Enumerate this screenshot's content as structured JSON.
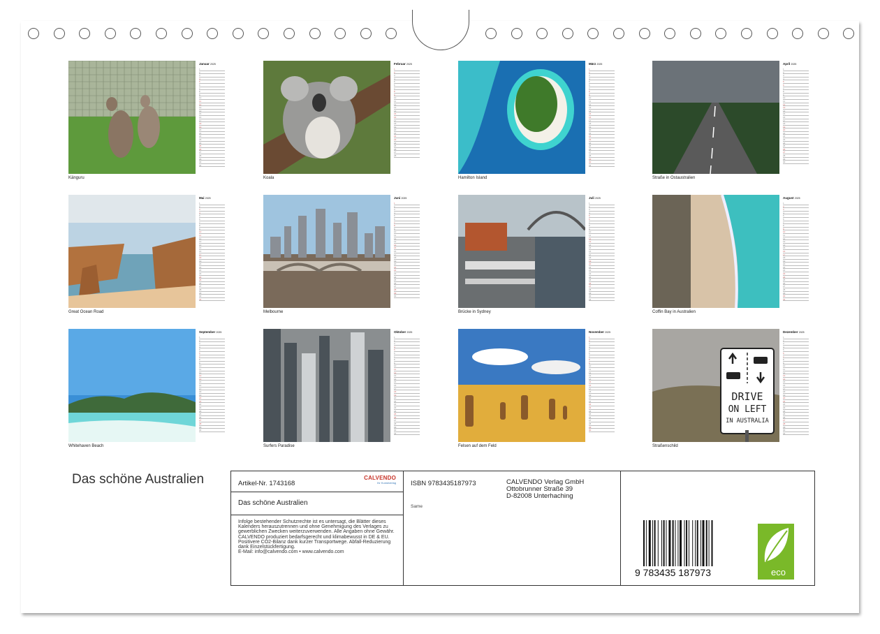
{
  "months": [
    {
      "id": "jan",
      "name": "Januar",
      "year": "2025",
      "caption": "Känguru",
      "days": 31,
      "photo": "kangaroo"
    },
    {
      "id": "feb",
      "name": "Februar",
      "year": "2025",
      "caption": "Koala",
      "days": 28,
      "photo": "koala"
    },
    {
      "id": "mar",
      "name": "März",
      "year": "2025",
      "caption": "Hamilton Island",
      "days": 31,
      "photo": "island"
    },
    {
      "id": "apr",
      "name": "April",
      "year": "2025",
      "caption": "Straße in Ostaustralien",
      "days": 30,
      "photo": "road"
    },
    {
      "id": "may",
      "name": "Mai",
      "year": "2025",
      "caption": "Great Ocean Road",
      "days": 31,
      "photo": "cliffs"
    },
    {
      "id": "jun",
      "name": "Juni",
      "year": "2025",
      "caption": "Melbourne",
      "days": 30,
      "photo": "melbourne"
    },
    {
      "id": "jul",
      "name": "Juli",
      "year": "2025",
      "caption": "Brücke in Sydney",
      "days": 31,
      "photo": "sydney"
    },
    {
      "id": "aug",
      "name": "August",
      "year": "2025",
      "caption": "Coffin Bay in Australien",
      "days": 31,
      "photo": "beach-aerial"
    },
    {
      "id": "sep",
      "name": "September",
      "year": "2025",
      "caption": "Whitehaven Beach",
      "days": 30,
      "photo": "whitehaven"
    },
    {
      "id": "oct",
      "name": "Oktober",
      "year": "2025",
      "caption": "Surfers Paradise",
      "days": 31,
      "photo": "skyscrapers"
    },
    {
      "id": "nov",
      "name": "November",
      "year": "2025",
      "caption": "Felsen auf dem Feld",
      "days": 30,
      "photo": "pinnacles"
    },
    {
      "id": "dec",
      "name": "Dezember",
      "year": "2025",
      "caption": "Straßenschild",
      "days": 31,
      "photo": "sign"
    }
  ],
  "weekday_abbr": [
    "Mi",
    "Do",
    "Fr",
    "Sa",
    "So",
    "Mo",
    "Di"
  ],
  "sign": {
    "line1": "DRIVE",
    "line2": "ON LEFT",
    "line3": "IN AUSTRALIA"
  },
  "title": "Das schöne Australien",
  "info": {
    "article": "Artikel-Nr. 1743168",
    "brand": "CALVENDO",
    "brand_sub": "Ihr Kunstverlag",
    "product_title": "Das schöne Australien",
    "legal": "Infolge bestehender Schutzrechte ist es untersagt, die Blätter dieses Kalenders herauszutrennen und ohne Genehmigung des Verlages zu gewerblichen Zwecken weiterzuverwenden. Alle Angaben ohne Gewähr.\nCALVENDO produziert bedarfsgerecht und klimabewusst in DE & EU. Positivere CO2-Bilanz dank kurzer Transportwege. Abfall-Reduzierung dank Einzelstückfertigung.\nE-Mail: info@calvendo.com • www.calvendo.com",
    "isbn": "ISBN 9783435187973",
    "author": "Same",
    "publisher_1": "CALVENDO Verlag GmbH",
    "publisher_2": "Ottobrunner Straße 39",
    "publisher_3": "D-82008 Unterhaching",
    "barcode_digits": "9 783435 187973",
    "eco_label": "eco"
  },
  "colors": {
    "weekend": "#cc6666",
    "eco": "#7ab929",
    "brand": "#c8352a"
  }
}
